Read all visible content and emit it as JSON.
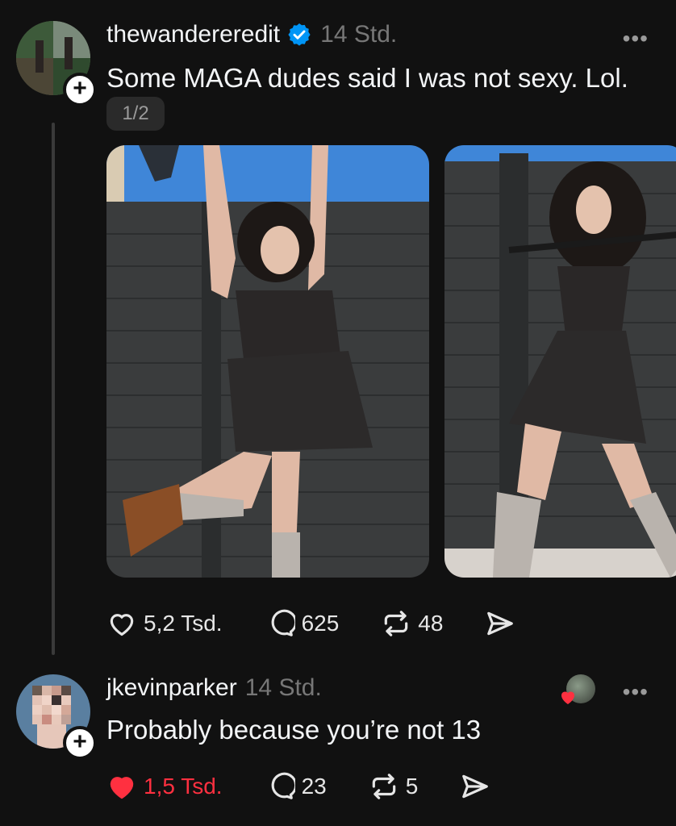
{
  "post": {
    "username": "thewandereredit",
    "time": "14 Std.",
    "text": "Some MAGA dudes said I was not sexy. Lol.",
    "page_indicator": "1/2",
    "more_label": "•••",
    "follow_label": "+",
    "actions": {
      "likes": "5,2 Tsd.",
      "comments": "625",
      "reposts": "48"
    }
  },
  "reply": {
    "username": "jkevinparker",
    "time": "14 Std.",
    "text": "Probably because you’re not 13",
    "more_label": "•••",
    "follow_label": "+",
    "actions": {
      "likes": "1,5 Tsd.",
      "comments": "23",
      "reposts": "5"
    }
  },
  "colors": {
    "background": "#111111",
    "verified": "#0095f6",
    "liked": "#ff3040"
  }
}
